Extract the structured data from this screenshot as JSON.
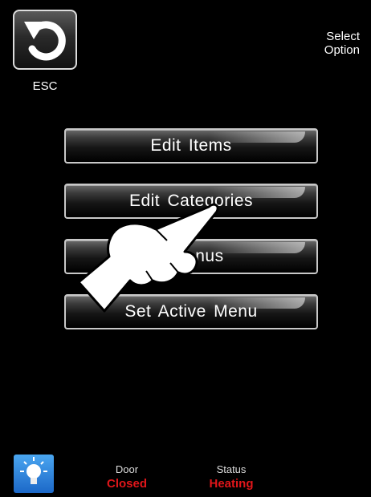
{
  "header": {
    "esc_label": "ESC",
    "prompt_line1": "Select",
    "prompt_line2": "Option"
  },
  "menu": {
    "items": [
      {
        "label": "Edit  Items"
      },
      {
        "label": "Edit  Categories"
      },
      {
        "label": ". Menus"
      },
      {
        "label": "Set  Active  Menu"
      }
    ]
  },
  "footer": {
    "door_label": "Door",
    "door_value": "Closed",
    "status_label": "Status",
    "status_value": "Heating"
  },
  "colors": {
    "background": "#000000",
    "status_value": "#e0161a",
    "bulb_button": "#2a7fd8"
  },
  "icons": {
    "esc": "undo-arrow-icon",
    "light": "lightbulb-icon",
    "pointer": "pointing-hand-icon"
  }
}
